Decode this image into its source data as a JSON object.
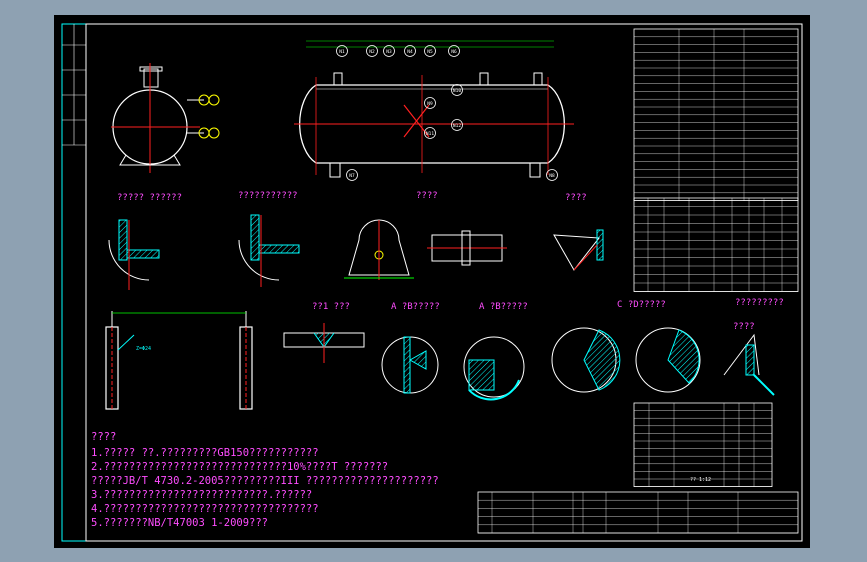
{
  "section_titles": [
    "????? ??????",
    "???????????",
    "????",
    "????",
    "??1 ???",
    "A ?B?????",
    "A ?B?????",
    "C ?D?????",
    "?????????",
    "????"
  ],
  "nozzle_labels": [
    "N1",
    "N2",
    "N3",
    "N4",
    "N5",
    "N6",
    "N7",
    "N8",
    "N9",
    "N10",
    "N11",
    "N12"
  ],
  "notes": {
    "heading": "????",
    "lines": [
      "1.????? ??.?????????GB150???????????",
      "2.?????????????????????????????10%????T ???????",
      "?????JB/T 4730.2-2005?????????III ?????????????????????",
      "3.??????????????????????????.??????",
      "4.??????????????????????????????????",
      "5.???????NB/T47003 1-2009???"
    ]
  },
  "saddle_label": "Z=Φ24",
  "table_stamp": "?? 1:12",
  "colors": {
    "background": "#8ea1b2",
    "sheet": "#000000",
    "frame": "#00ffff",
    "center_line": "#ff2020",
    "leader": "#ffff00",
    "dimension": "#00ff00",
    "hatch": "#00ffff",
    "text_annotation": "#ff4dff"
  }
}
